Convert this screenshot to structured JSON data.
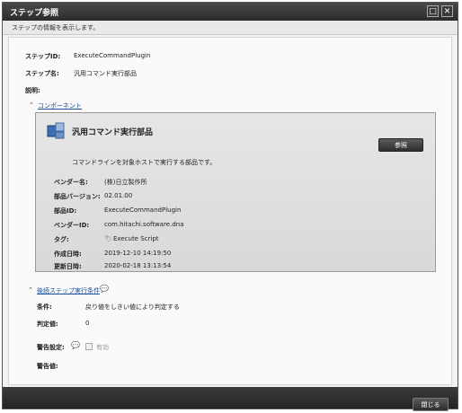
{
  "window": {
    "title": "ステップ参照",
    "subtitle": "ステップの情報を表示します。",
    "maximize_icon": "maximize-icon",
    "close_icon": "close-icon"
  },
  "step": {
    "id_label": "ステップID:",
    "id_value": "ExecuteCommandPlugin",
    "name_label": "ステップ名:",
    "name_value": "汎用コマンド実行部品",
    "desc_label": "説明:"
  },
  "component": {
    "section_title": "コンポーネント",
    "title": "汎用コマンド実行部品",
    "description": "コマンドラインを対象ホストで実行する部品です。",
    "reference_button": "参照",
    "rows": [
      {
        "label": "ベンダー名:",
        "value": "(株)日立製作所"
      },
      {
        "label": "部品バージョン:",
        "value": "02.01.00"
      },
      {
        "label": "部品ID:",
        "value": "ExecuteCommandPlugin"
      },
      {
        "label": "ベンダーID:",
        "value": "com.hitachi.software.dna"
      },
      {
        "label": "タグ:",
        "value": "Execute Script"
      },
      {
        "label": "作成日時:",
        "value": "2019-12-10 14:19:50"
      },
      {
        "label": "更新日時:",
        "value": "2020-02-18 13:13:54"
      }
    ]
  },
  "condition": {
    "section_title": "後続ステップ実行条件",
    "cond_label": "条件:",
    "cond_value": "戻り値をしきい値により判定する",
    "threshold_label": "判定値:",
    "threshold_value": "0",
    "warn_setting_label": "警告設定:",
    "warn_checkbox_label": "有効",
    "warn_value_label": "警告値:"
  },
  "footer": {
    "close_button": "閉じる"
  }
}
